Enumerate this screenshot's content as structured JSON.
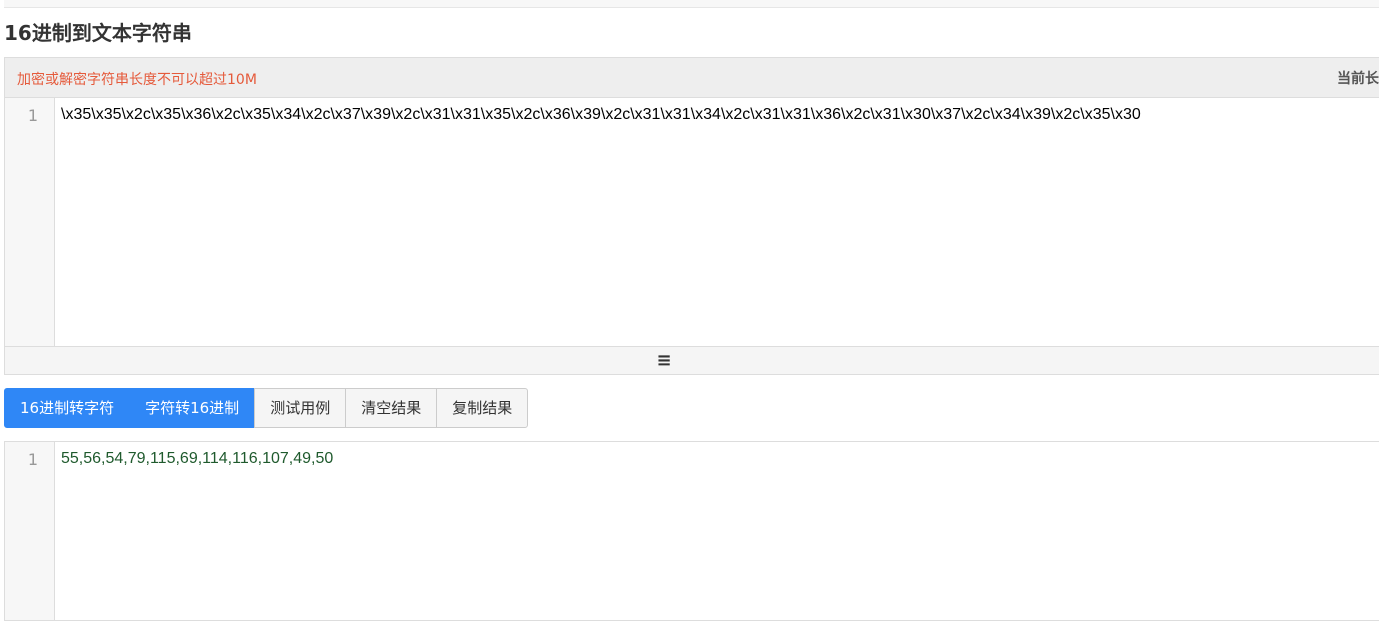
{
  "page_title": "16进制到文本字符串",
  "input_panel": {
    "warning": "加密或解密字符串长度不可以超过10M",
    "current_length_label": "当前长",
    "line_number": "1",
    "code": "\\x35\\x35\\x2c\\x35\\x36\\x2c\\x35\\x34\\x2c\\x37\\x39\\x2c\\x31\\x31\\x35\\x2c\\x36\\x39\\x2c\\x31\\x31\\x34\\x2c\\x31\\x31\\x36\\x2c\\x31\\x30\\x37\\x2c\\x34\\x39\\x2c\\x35\\x30",
    "resize_icon": "≡"
  },
  "buttons": [
    {
      "label": "16进制转字符",
      "primary": true
    },
    {
      "label": "字符转16进制",
      "primary": true
    },
    {
      "label": "测试用例",
      "primary": false
    },
    {
      "label": "清空结果",
      "primary": false
    },
    {
      "label": "复制结果",
      "primary": false
    }
  ],
  "output_panel": {
    "line_number": "1",
    "code": "55,56,54,79,115,69,114,116,107,49,50"
  },
  "colors": {
    "primary": "#2f87f6",
    "warning": "#e55a3b",
    "output_text": "#1f5a2d"
  }
}
